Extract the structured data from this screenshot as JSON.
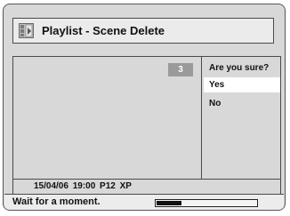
{
  "header": {
    "title": "Playlist - Scene Delete",
    "icon": "playlist-icon"
  },
  "preview": {
    "scene_number": "3"
  },
  "confirm": {
    "question": "Are you sure?",
    "options": [
      {
        "label": "Yes",
        "selected": true
      },
      {
        "label": "No",
        "selected": false
      }
    ]
  },
  "info": {
    "text": "15/04/06 19:00 P12 XP"
  },
  "status": {
    "message": "Wait for a moment.",
    "progress": 0.25
  },
  "colors": {
    "panel_background": "#d8d8d8",
    "selected_background": "#ffffff",
    "badge_background": "#9a9a9a",
    "border": "#4a4a4a"
  }
}
